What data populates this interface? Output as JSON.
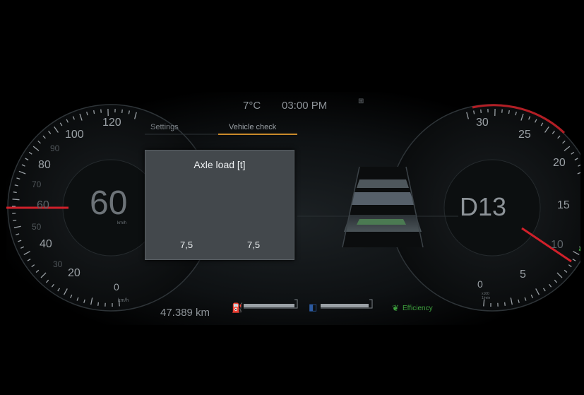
{
  "header": {
    "temperature": "7°C",
    "time": "03:00 PM"
  },
  "tabs": [
    {
      "label": "Settings",
      "active": false
    },
    {
      "label": "Vehicle check",
      "active": true
    }
  ],
  "speedometer": {
    "speed": "60",
    "unit": "km/h",
    "scale_labels": [
      "0",
      "20",
      "40",
      "60",
      "80",
      "100",
      "120"
    ],
    "minor_labels": [
      "30",
      "50",
      "70",
      "90"
    ],
    "bottom_unit": "km/h"
  },
  "axle_load": {
    "title": "Axle load [t]",
    "front_value": "7,5",
    "rear_value": "7,5"
  },
  "gear": {
    "display": "D13"
  },
  "tachometer": {
    "scale_labels": [
      "0",
      "5",
      "10",
      "15",
      "20",
      "25",
      "30"
    ],
    "unit": "x100\n1/min"
  },
  "footer": {
    "odometer": "47.389 km",
    "efficiency_label": "Efficiency"
  },
  "colors": {
    "needle": "#d0202a",
    "accent": "#c98a2a",
    "efficiency_green": "#3ea33e",
    "panel": "#43484c"
  },
  "icons": [
    "fuel-icon",
    "adblue-icon",
    "leaf-icon",
    "trailer-icon"
  ]
}
